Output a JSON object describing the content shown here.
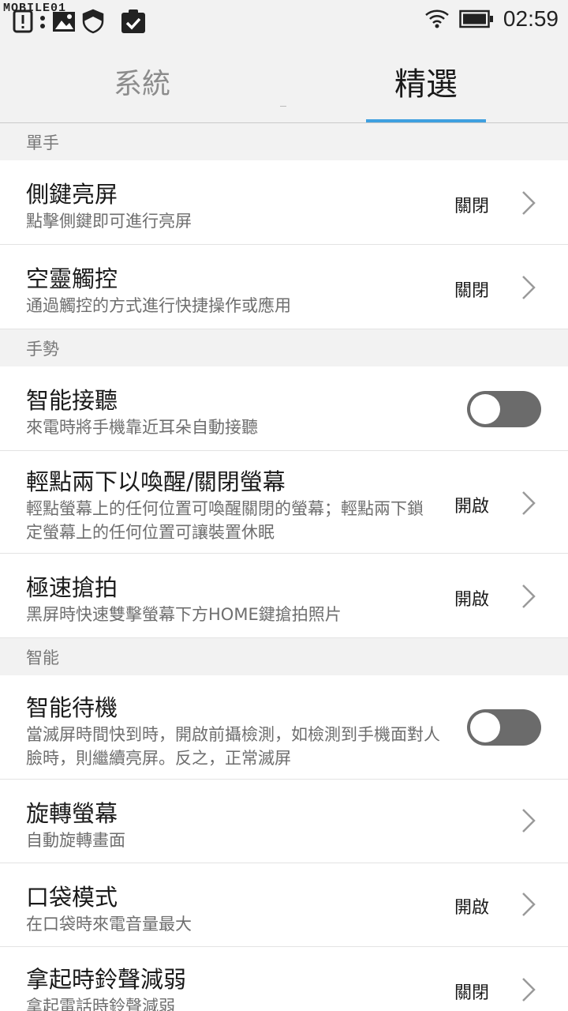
{
  "status_bar": {
    "watermark": "MOBILE01",
    "time": "02:59",
    "icons": [
      "alert-icon",
      "more-dots-icon",
      "image-icon",
      "shield-icon",
      "clipboard-check-icon",
      "wifi-icon",
      "battery-icon"
    ]
  },
  "tabs": [
    {
      "label": "系統",
      "active": false
    },
    {
      "label": "精選",
      "active": true
    }
  ],
  "sections": [
    {
      "header": "單手",
      "items": [
        {
          "title": "側鍵亮屏",
          "subtitle": "點擊側鍵即可進行亮屏",
          "value": "關閉",
          "control": "chevron"
        },
        {
          "title": "空靈觸控",
          "subtitle": "通過觸控的方式進行快捷操作或應用",
          "value": "關閉",
          "control": "chevron"
        }
      ]
    },
    {
      "header": "手勢",
      "items": [
        {
          "title": "智能接聽",
          "subtitle": "來電時將手機靠近耳朵自動接聽",
          "value": "",
          "control": "toggle",
          "on": false
        },
        {
          "title": "輕點兩下以喚醒/關閉螢幕",
          "subtitle": "輕點螢幕上的任何位置可喚醒關閉的螢幕；輕點兩下鎖定螢幕上的任何位置可讓裝置休眠",
          "value": "開啟",
          "control": "chevron"
        },
        {
          "title": "極速搶拍",
          "subtitle": "黑屏時快速雙擊螢幕下方HOME鍵搶拍照片",
          "value": "開啟",
          "control": "chevron"
        }
      ]
    },
    {
      "header": "智能",
      "items": [
        {
          "title": "智能待機",
          "subtitle": "當滅屏時間快到時，開啟前攝檢測，如檢測到手機面對人臉時，則繼續亮屏。反之，正常滅屏",
          "value": "",
          "control": "toggle",
          "on": false
        },
        {
          "title": "旋轉螢幕",
          "subtitle": "自動旋轉畫面",
          "value": "",
          "control": "chevron"
        },
        {
          "title": "口袋模式",
          "subtitle": "在口袋時來電音量最大",
          "value": "開啟",
          "control": "chevron"
        },
        {
          "title": "拿起時鈴聲減弱",
          "subtitle": "拿起電話時鈴聲減弱",
          "value": "關閉",
          "control": "chevron"
        }
      ]
    }
  ],
  "colors": {
    "accent": "#3fa0e0",
    "background": "#f2f2f2",
    "item_background": "#ffffff",
    "toggle_off": "#6b6b6b"
  }
}
